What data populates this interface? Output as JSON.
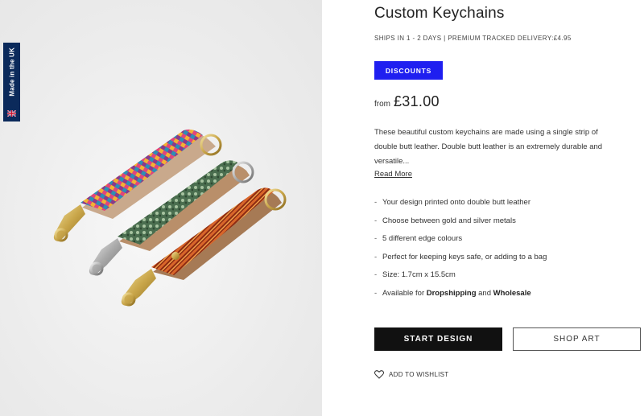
{
  "badge": {
    "made_in_uk": "Made in the UK"
  },
  "product": {
    "title": "Custom Keychains",
    "shipping": "SHIPS IN 1 - 2 DAYS | PREMIUM TRACKED DELIVERY:£4.95",
    "discounts_label": "DISCOUNTS",
    "price_prefix": "from",
    "price": "£31.00",
    "description_line1": "These beautiful custom keychains are made using a single strip of",
    "description_line2": "double butt leather. Double butt leather is an extremely durable and",
    "description_line3": "versatile...",
    "read_more": "Read More",
    "features": [
      "Your design printed onto double butt leather",
      "Choose between gold and silver metals",
      "5 different edge colours",
      "Perfect for keeping keys safe, or adding to a bag",
      "Size: 1.7cm x 15.5cm"
    ],
    "feature_last": {
      "prefix": "Available for",
      "link1": "Dropshipping",
      "middle": "and",
      "link2": "Wholesale"
    },
    "start_design": "START DESIGN",
    "shop_art": "SHOP ART",
    "wishlist": "ADD TO WISHLIST"
  },
  "icons": {
    "flag": "uk-flag-icon",
    "heart": "heart-outline-icon"
  },
  "colors": {
    "discount_button": "#1f1ff0",
    "primary_button": "#111111",
    "uk_badge": "#0b2a5b"
  }
}
